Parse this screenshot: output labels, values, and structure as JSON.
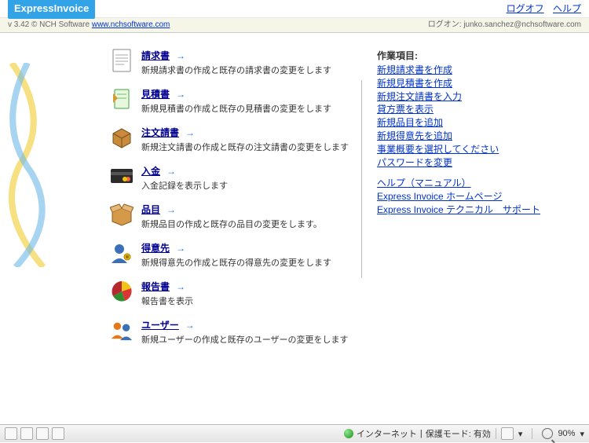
{
  "header": {
    "logo": "ExpressInvoice",
    "links": {
      "logoff": "ログオフ",
      "help": "ヘルプ"
    }
  },
  "subbar": {
    "left_prefix": "v 3.42 © NCH Software ",
    "left_link": "www.nchsoftware.com",
    "right": "ログオン: junko.sanchez@nchsoftware.com"
  },
  "menu": [
    {
      "title": "請求書",
      "desc": "新規請求書の作成と既存の請求書の変更をします"
    },
    {
      "title": "見積書",
      "desc": "新規見積書の作成と既存の見積書の変更をします"
    },
    {
      "title": "注文請書",
      "desc": "新規注文請書の作成と既存の注文請書の変更をします"
    },
    {
      "title": "入金",
      "desc": "入金記録を表示します"
    },
    {
      "title": "品目",
      "desc": "新規品目の作成と既存の品目の変更をします。"
    },
    {
      "title": "得意先",
      "desc": "新規得意先の作成と既存の得意先の変更をします"
    },
    {
      "title": "報告書",
      "desc": "報告書を表示"
    },
    {
      "title": "ユーザー",
      "desc": "新規ユーザーの作成と既存のユーザーの変更をします"
    }
  ],
  "arrow": "→",
  "side": {
    "heading": "作業項目:",
    "links1": [
      "新規請求書を作成",
      "新規見積書を作成",
      "新規注文請書を入力",
      "貸方票を表示",
      "新規品目を追加",
      "新規得意先を追加",
      "事業概要を選択してください",
      "パスワードを変更"
    ],
    "links2": [
      "ヘルプ（マニュアル）",
      "Express Invoice ホームページ",
      "Express Invoice テクニカル　サポート"
    ]
  },
  "status": {
    "internet": "インターネット",
    "protected": "保護モード: 有効",
    "zoom": "90%"
  }
}
